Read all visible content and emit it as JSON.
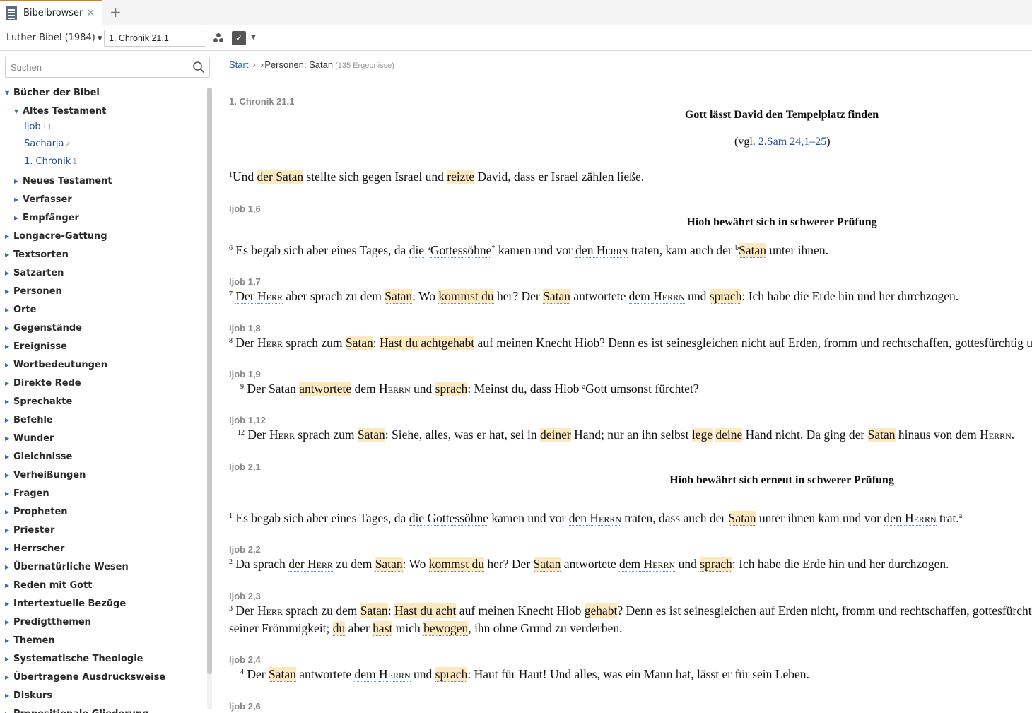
{
  "tab": {
    "title": "Bibelbrowser",
    "close": "✕",
    "add": "+"
  },
  "toolbar": {
    "bible": "Luther Bibel (1984)",
    "reference": "1. Chronik 21,1"
  },
  "search": {
    "placeholder": "Suchen"
  },
  "tree": {
    "root": "Bücher der Bibel",
    "at": "Altes Testament",
    "leaves": [
      {
        "label": "Ijob",
        "count": "11"
      },
      {
        "label": "Sacharja",
        "count": "2"
      },
      {
        "label": "1. Chronik",
        "count": "1"
      }
    ],
    "sub": [
      "Neues Testament",
      "Verfasser",
      "Empfänger"
    ],
    "top": [
      "Longacre-Gattung",
      "Textsorten",
      "Satzarten",
      "Personen",
      "Orte",
      "Gegenstände",
      "Ereignisse",
      "Wortbedeutungen",
      "Direkte Rede",
      "Sprechakte",
      "Befehle",
      "Wunder",
      "Gleichnisse",
      "Verheißungen",
      "Fragen",
      "Propheten",
      "Priester",
      "Herrscher",
      "Übernatürliche Wesen",
      "Reden mit Gott",
      "Intertextuelle Bezüge",
      "Predigtthemen",
      "Themen",
      "Systematische Theologie",
      "Übertragene Ausdrucksweise",
      "Diskurs",
      "Propositionale Gliederung"
    ]
  },
  "breadcrumb": {
    "start": "Start",
    "sep": "›",
    "x": "×",
    "term": "Personen: Satan",
    "results": "(135 Ergebnisse)"
  },
  "refs": [
    "1. Chronik 21,1",
    "Ijob 1,6",
    "Ijob 1,7",
    "Ijob 1,8",
    "Ijob 1,9",
    "Ijob 1,12",
    "Ijob 2,1",
    "Ijob 2,2",
    "Ijob 2,3",
    "Ijob 2,4",
    "Ijob 2,6"
  ],
  "headings": [
    "Gott lässt David den Tempelplatz finden",
    "Hiob bewährt sich in schwerer Prüfung",
    "Hiob bewährt sich erneut in schwerer Prüfung"
  ],
  "parallel": {
    "pre": "(vgl. ",
    "link": "2.Sam 24,1–25",
    "post": ")"
  },
  "verses": {
    "v1": [
      "1",
      "Und ",
      "der Satan",
      " stellte sich gegen ",
      "Israel",
      " und ",
      "reizte",
      " ",
      "David",
      ", dass er ",
      "Israel",
      " zählen ließe."
    ],
    "v2": [
      "6",
      " Es begab sich aber eines Tages, da ",
      "die",
      " ",
      "a",
      "Gottessöhne",
      "*",
      " kamen und vor ",
      "den ",
      "Herrn",
      " traten, kam auch der ",
      "b",
      "Satan",
      " unter ihnen."
    ],
    "v3": [
      "7",
      " ",
      "Der ",
      "Herr",
      " aber sprach zu dem ",
      "Satan",
      ": Wo ",
      "kommst du",
      " her? Der ",
      "Satan",
      " antwortete ",
      "dem ",
      "Herrn",
      " und ",
      "sprach",
      ": Ich habe die Erde hin und her durchzogen."
    ],
    "v4": [
      "8",
      " ",
      "Der ",
      "Herr",
      " sprach zum ",
      "Satan",
      ": ",
      "Hast du achtgehabt",
      " auf ",
      "meinen Knecht",
      " ",
      "Hiob",
      "? Denn es ist seinesgleichen nicht auf Erden, ",
      "fromm",
      " ",
      "und",
      " ",
      "rechtschaffen",
      ", gottesfürchtig und meidet das Böse."
    ],
    "v5": [
      "9",
      " Der Satan ",
      "antwortete",
      " ",
      "dem ",
      "Herrn",
      " und ",
      "sprach",
      ": Meinst du, dass ",
      "Hiob",
      " ",
      "a",
      "Gott",
      " umsonst fürchtet?"
    ],
    "v6": [
      "12",
      " ",
      "Der ",
      "Herr",
      " sprach zum ",
      "Satan",
      ": Siehe, alles, was er hat, sei in ",
      "deiner",
      " Hand; nur an ihn selbst ",
      "lege",
      " ",
      "deine",
      " Hand nicht. Da ging der ",
      "Satan",
      " hinaus von ",
      "dem ",
      "Herrn",
      "."
    ],
    "v7": [
      "1",
      " Es begab sich aber eines Tages, da ",
      "die Gottessöhne",
      " kamen und vor ",
      "den ",
      "Herrn",
      " traten, dass auch der ",
      "Satan",
      " unter ihnen kam und vor ",
      "den ",
      "Herrn",
      " trat.",
      "a"
    ],
    "v8": [
      "2",
      " Da sprach ",
      "der ",
      "Herr",
      " zu dem ",
      "Satan",
      ": Wo ",
      "kommst du",
      " her? Der ",
      "Satan",
      " antwortete ",
      "dem ",
      "Herrn",
      " und ",
      "sprach",
      ": Ich habe die Erde hin und her durchzogen."
    ],
    "v9": [
      "3",
      " ",
      "Der ",
      "Herr",
      " sprach zu dem ",
      "Satan",
      ": ",
      "Hast du acht",
      " auf ",
      "meinen Knecht",
      " ",
      "Hiob",
      " ",
      "gehabt",
      "? Denn es ist seinesgleichen auf Erden nicht, ",
      "fromm",
      " ",
      "und",
      " ",
      "rechtschaffen",
      ", gottesfürchtig und meidet das Böse und hält noch fest an"
    ],
    "v9b": [
      "seiner Frömmigkeit; ",
      "du",
      " aber ",
      "hast",
      " mich ",
      "bewogen",
      ", ihn ohne Grund zu verderben."
    ],
    "v10": [
      "4",
      " Der ",
      "Satan",
      " antwortete ",
      "dem ",
      "Herrn",
      " und ",
      "sprach",
      ": Haut für Haut! Und alles, was ein Mann hat, lässt er für sein Leben."
    ]
  }
}
